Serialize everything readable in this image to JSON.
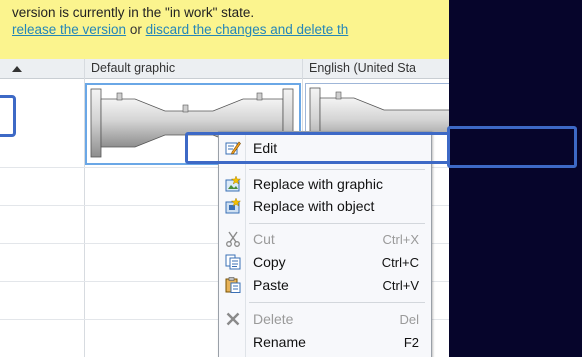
{
  "notice": {
    "line1": "version is currently in the \"in work\" state.",
    "link_release": "release the version",
    "separator": "or",
    "link_discard": "discard the changes and delete th"
  },
  "table": {
    "columns": [
      "Default graphic",
      "English (United Sta"
    ]
  },
  "context_menu": {
    "items": [
      {
        "label": "Edit",
        "shortcut": "",
        "icon": "edit-icon",
        "enabled": true
      },
      {
        "label": "Replace with graphic",
        "shortcut": "",
        "icon": "replace-graphic-icon",
        "enabled": true
      },
      {
        "label": "Replace with object",
        "shortcut": "",
        "icon": "replace-object-icon",
        "enabled": true
      },
      {
        "label": "Cut",
        "shortcut": "Ctrl+X",
        "icon": "scissors-icon",
        "enabled": false
      },
      {
        "label": "Copy",
        "shortcut": "Ctrl+C",
        "icon": "copy-icon",
        "enabled": true
      },
      {
        "label": "Paste",
        "shortcut": "Ctrl+V",
        "icon": "paste-icon",
        "enabled": true
      },
      {
        "label": "Delete",
        "shortcut": "Del",
        "icon": "delete-x-icon",
        "enabled": false
      },
      {
        "label": "Rename",
        "shortcut": "F2",
        "icon": "",
        "enabled": true
      }
    ]
  },
  "colors": {
    "highlight": "#3d69c6",
    "notice_bg": "#fbf48e",
    "link": "#2486b8",
    "background": "#06052b"
  }
}
